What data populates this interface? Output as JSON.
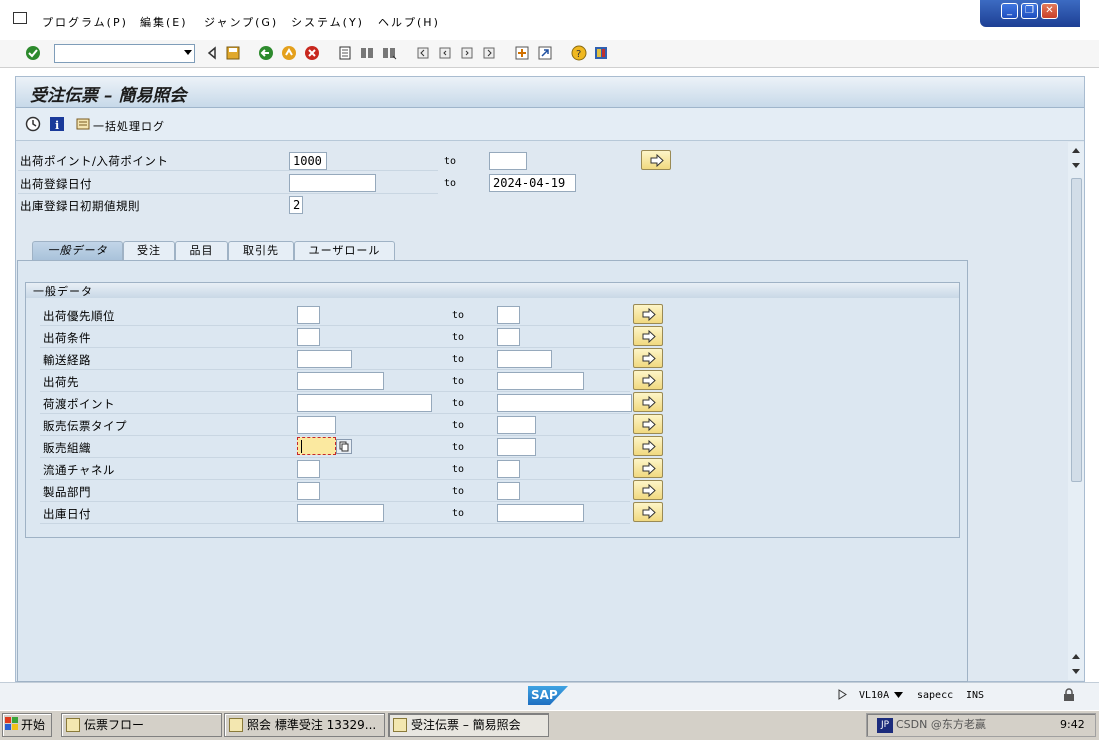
{
  "menu": {
    "items": [
      "プログラム(P)",
      "編集(E)",
      "ジャンプ(G)",
      "システム(Y)",
      "ヘルプ(H)"
    ]
  },
  "window_controls": [
    "minimize-icon",
    "restore-icon",
    "close-icon"
  ],
  "toolbar": {
    "command_field": "",
    "icons": [
      "enter-check-icon",
      "command-dropdown-icon",
      "back-triangle-icon",
      "save-icon",
      "back-icon",
      "exit-icon",
      "cancel-icon",
      "print-icon",
      "find-icon",
      "find-next-icon",
      "first-page-icon",
      "prev-page-icon",
      "next-page-icon",
      "last-page-icon",
      "new-session-icon",
      "shortcut-icon",
      "help-icon",
      "layout-icon"
    ]
  },
  "page": {
    "title": "受注伝票 – 簡易照会"
  },
  "app_toolbar": {
    "execute_icon": "clock-execute-icon",
    "info_icon": "info-icon",
    "bulk_log_label": "一括処理ログ"
  },
  "header_fields": [
    {
      "label": "出荷ポイント/入荷ポイント",
      "from": "1000",
      "to_label": "to",
      "to": ""
    },
    {
      "label": "出荷登録日付",
      "from": "",
      "to_label": "to",
      "to": "2024-04-19"
    },
    {
      "label": "出庫登録日初期値規則",
      "from": "2"
    }
  ],
  "tabs": [
    {
      "label": "一般データ",
      "active": true
    },
    {
      "label": "受注",
      "active": false
    },
    {
      "label": "品目",
      "active": false
    },
    {
      "label": "取引先",
      "active": false
    },
    {
      "label": "ユーザロール",
      "active": false
    }
  ],
  "group": {
    "title": "一般データ",
    "rows": [
      {
        "label": "出荷優先順位",
        "from": "",
        "to_label": "to",
        "to": ""
      },
      {
        "label": "出荷条件",
        "from": "",
        "to_label": "to",
        "to": ""
      },
      {
        "label": "輸送経路",
        "from": "",
        "to_label": "to",
        "to": ""
      },
      {
        "label": "出荷先",
        "from": "",
        "to_label": "to",
        "to": ""
      },
      {
        "label": "荷渡ポイント",
        "from": "",
        "to_label": "to",
        "to": ""
      },
      {
        "label": "販売伝票タイプ",
        "from": "",
        "to_label": "to",
        "to": ""
      },
      {
        "label": "販売組織",
        "from": "",
        "to_label": "to",
        "to": ""
      },
      {
        "label": "流通チャネル",
        "from": "",
        "to_label": "to",
        "to": ""
      },
      {
        "label": "製品部門",
        "from": "",
        "to_label": "to",
        "to": ""
      },
      {
        "label": "出庫日付",
        "from": "",
        "to_label": "to",
        "to": ""
      }
    ]
  },
  "status_bar": {
    "logo": "SAP",
    "transaction": "VL10A",
    "system": "sapecc",
    "mode": "INS"
  },
  "taskbar": {
    "start": "开始",
    "tasks": [
      "伝票フロー",
      "照会 標準受注 13329...",
      "受注伝票 – 簡易照会"
    ],
    "ime": "JP",
    "tray_text": "CSDN @东方老赢",
    "clock": "9:42"
  }
}
